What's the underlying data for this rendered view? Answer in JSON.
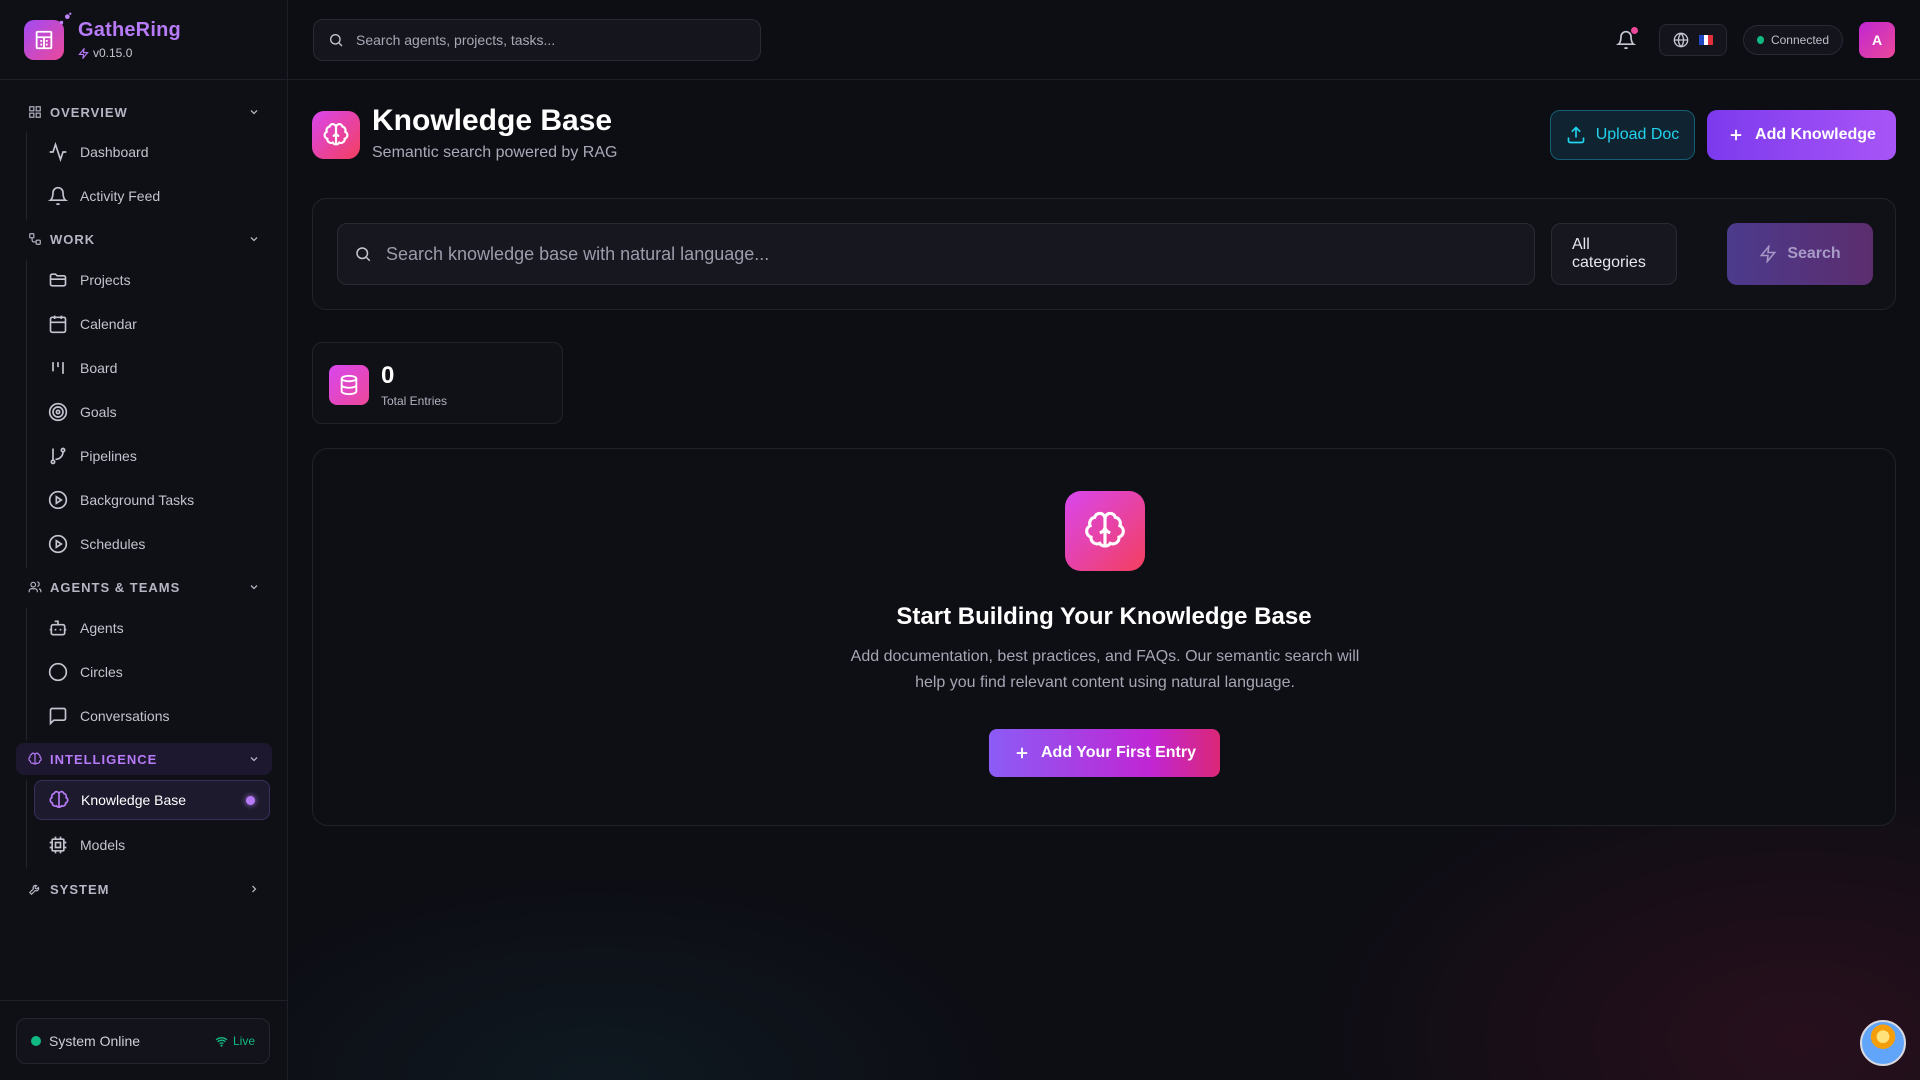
{
  "brand": {
    "name": "GatheRing",
    "version": "v0.15.0"
  },
  "search": {
    "placeholder": "Search agents, projects, tasks..."
  },
  "nav": {
    "sections": [
      {
        "label": "OVERVIEW",
        "items": [
          "Dashboard",
          "Activity Feed"
        ]
      },
      {
        "label": "WORK",
        "items": [
          "Projects",
          "Calendar",
          "Board",
          "Goals",
          "Pipelines",
          "Background Tasks",
          "Schedules"
        ]
      },
      {
        "label": "AGENTS & TEAMS",
        "items": [
          "Agents",
          "Circles",
          "Conversations"
        ]
      },
      {
        "label": "INTELLIGENCE",
        "items": [
          "Knowledge Base",
          "Models"
        ],
        "active": true
      },
      {
        "label": "SYSTEM",
        "items": []
      }
    ],
    "active_item": "Knowledge Base"
  },
  "status": {
    "system": "System Online",
    "live": "Live"
  },
  "topbar": {
    "connection": "Connected",
    "avatar": "A",
    "language_flag": "fr-flag",
    "has_notification": true
  },
  "page": {
    "title": "Knowledge Base",
    "subtitle": "Semantic search powered by RAG"
  },
  "actions": {
    "upload": "Upload Doc",
    "add": "Add Knowledge"
  },
  "kb_search": {
    "placeholder": "Search knowledge base with natural language...",
    "category": "All categories",
    "button": "Search"
  },
  "stats": {
    "total_value": "0",
    "total_label": "Total Entries"
  },
  "empty": {
    "title": "Start Building Your Knowledge Base",
    "desc": "Add documentation, best practices, and FAQs. Our semantic search will help you find relevant content using natural language.",
    "button": "Add Your First Entry"
  },
  "colors": {
    "accent": "#a855f7",
    "brand": "#b77bf7",
    "pink": "#ec4899",
    "cyan": "#22d3ee",
    "online": "#10b981"
  }
}
